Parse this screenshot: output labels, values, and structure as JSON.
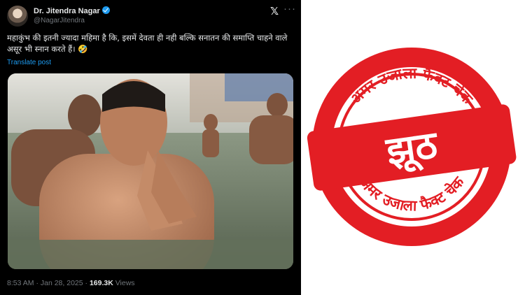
{
  "tweet": {
    "author_name": "Dr. Jitendra Nagar",
    "handle": "@NagarJitendra",
    "text": "महाकुंभ की इतनी ज्यादा महिमा है कि, इसमें देवता ही नही बल्कि सनातन की समाप्ति चाहने वाले असूर भी स्नान करते हैं। 🤣",
    "translate_label": "Translate post",
    "time": "8:53 AM",
    "date": "Jan 28, 2025",
    "views_count": "169.3K",
    "views_label": "Views",
    "x_logo": "𝕏",
    "more_label": "···"
  },
  "stamp": {
    "ring_text_top": "अमर उजाला फैक्ट चेक",
    "ring_text_bottom": "अमर उजाला फैक्ट चेक",
    "verdict": "झूठ",
    "color": "#e31e24"
  },
  "icons": [
    "verified-badge-icon",
    "x-logo-icon",
    "more-options-icon"
  ]
}
